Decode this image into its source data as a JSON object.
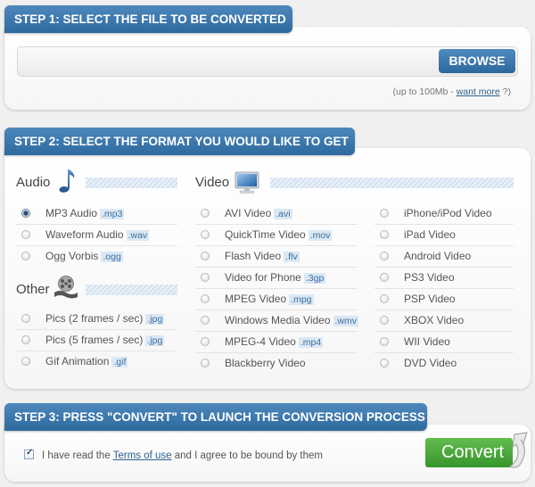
{
  "step1": {
    "title": "STEP 1: SELECT THE FILE TO BE CONVERTED",
    "file_value": "",
    "browse_label": "BROWSE",
    "limit_prefix": "(up to 100Mb - ",
    "limit_link": "want more",
    "limit_suffix": " ?)"
  },
  "step2": {
    "title": "STEP 2: SELECT THE FORMAT YOU WOULD LIKE TO GET",
    "audio": {
      "title": "Audio",
      "icon": "music-note-icon",
      "options": [
        {
          "label": "MP3 Audio",
          "ext": ".mp3",
          "selected": true
        },
        {
          "label": "Waveform Audio",
          "ext": ".wav",
          "selected": false
        },
        {
          "label": "Ogg Vorbis",
          "ext": ".ogg",
          "selected": false
        }
      ]
    },
    "other": {
      "title": "Other",
      "icon": "film-reel-icon",
      "options": [
        {
          "label": "Pics (2 frames / sec)",
          "ext": ".jpg",
          "selected": false
        },
        {
          "label": "Pics (5 frames / sec)",
          "ext": ".jpg",
          "selected": false
        },
        {
          "label": "Gif Animation",
          "ext": ".gif",
          "selected": false
        }
      ]
    },
    "video": {
      "title": "Video",
      "icon": "monitor-icon",
      "options_col1": [
        {
          "label": "AVI Video",
          "ext": ".avi",
          "selected": false
        },
        {
          "label": "QuickTime Video",
          "ext": ".mov",
          "selected": false
        },
        {
          "label": "Flash Video",
          "ext": ".flv",
          "selected": false
        },
        {
          "label": "Video for Phone",
          "ext": ".3gp",
          "selected": false
        },
        {
          "label": "MPEG Video",
          "ext": ".mpg",
          "selected": false
        },
        {
          "label": "Windows Media Video",
          "ext": ".wmv",
          "selected": false
        },
        {
          "label": "MPEG-4 Video",
          "ext": ".mp4",
          "selected": false
        },
        {
          "label": "Blackberry Video",
          "ext": "",
          "selected": false
        }
      ],
      "options_col2": [
        {
          "label": "iPhone/iPod Video",
          "ext": "",
          "selected": false
        },
        {
          "label": "iPad Video",
          "ext": "",
          "selected": false
        },
        {
          "label": "Android Video",
          "ext": "",
          "selected": false
        },
        {
          "label": "PS3 Video",
          "ext": "",
          "selected": false
        },
        {
          "label": "PSP Video",
          "ext": "",
          "selected": false
        },
        {
          "label": "XBOX Video",
          "ext": "",
          "selected": false
        },
        {
          "label": "WII Video",
          "ext": "",
          "selected": false
        },
        {
          "label": "DVD Video",
          "ext": "",
          "selected": false
        }
      ]
    }
  },
  "step3": {
    "title": "STEP 3: PRESS \"CONVERT\" TO LAUNCH THE CONVERSION PROCESS",
    "agree_checked": true,
    "agree_prefix": "I have read the ",
    "agree_link": "Terms of use",
    "agree_suffix": " and I agree to be bound by them",
    "convert_label": "Convert"
  },
  "colors": {
    "header_blue": "#3a77ad",
    "convert_green": "#4caa3c",
    "ext_bg": "#dbe8f4",
    "link": "#2c5f8a"
  }
}
